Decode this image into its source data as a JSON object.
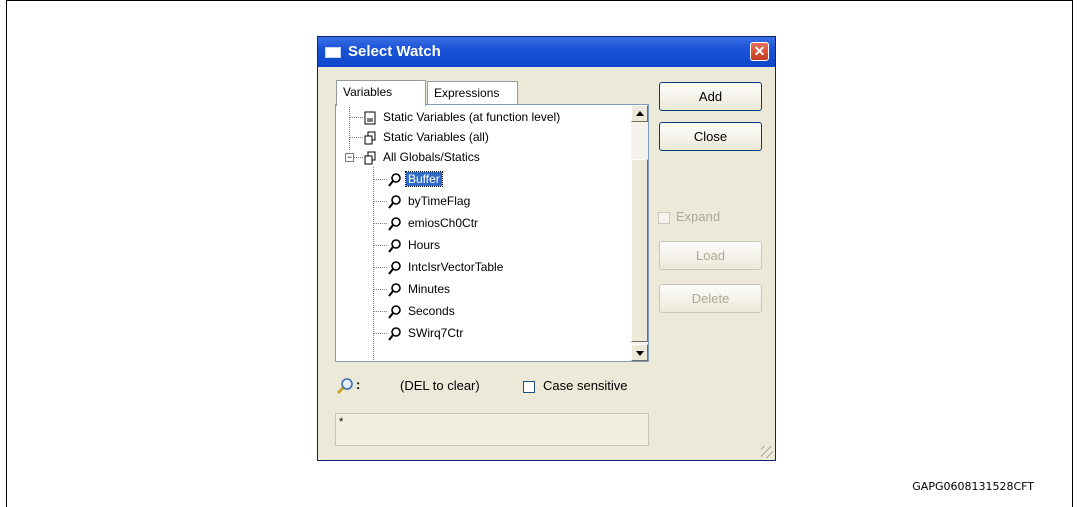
{
  "window": {
    "title": "Select Watch",
    "close_glyph": "✕"
  },
  "tabs": [
    {
      "label": "Variables",
      "active": true
    },
    {
      "label": "Expressions",
      "active": false
    }
  ],
  "tree": {
    "items": [
      {
        "label": "Static Variables (at function level)",
        "icon": "document-icon"
      },
      {
        "label": "Static Variables (all)",
        "icon": "variables-group-icon"
      },
      {
        "label": "All Globals/Statics",
        "icon": "variables-group-icon",
        "expanded": true
      },
      {
        "label": "Buffer",
        "icon": "watch-variable-icon",
        "selected": true
      },
      {
        "label": "byTimeFlag",
        "icon": "watch-variable-icon"
      },
      {
        "label": "emiosCh0Ctr",
        "icon": "watch-variable-icon"
      },
      {
        "label": "Hours",
        "icon": "watch-variable-icon"
      },
      {
        "label": "IntcIsrVectorTable",
        "icon": "watch-variable-icon"
      },
      {
        "label": "Minutes",
        "icon": "watch-variable-icon"
      },
      {
        "label": "Seconds",
        "icon": "watch-variable-icon"
      },
      {
        "label": "SWirq7Ctr",
        "icon": "watch-variable-icon"
      }
    ],
    "expander_glyph": "−"
  },
  "buttons": {
    "add": "Add",
    "close": "Close",
    "load": "Load",
    "delete": "Delete"
  },
  "expand": {
    "label": "Expand",
    "checked": false,
    "enabled": false
  },
  "filter": {
    "colon": ":",
    "hint": "(DEL to clear)",
    "case_sensitive_label": "Case sensitive",
    "case_sensitive_checked": false,
    "value": "*"
  },
  "figure_id": "GAPG0608131528CFT",
  "colors": {
    "titlebar": "#0d46c8",
    "dialog_background": "#ece9d8",
    "selection": "#316ac5"
  }
}
